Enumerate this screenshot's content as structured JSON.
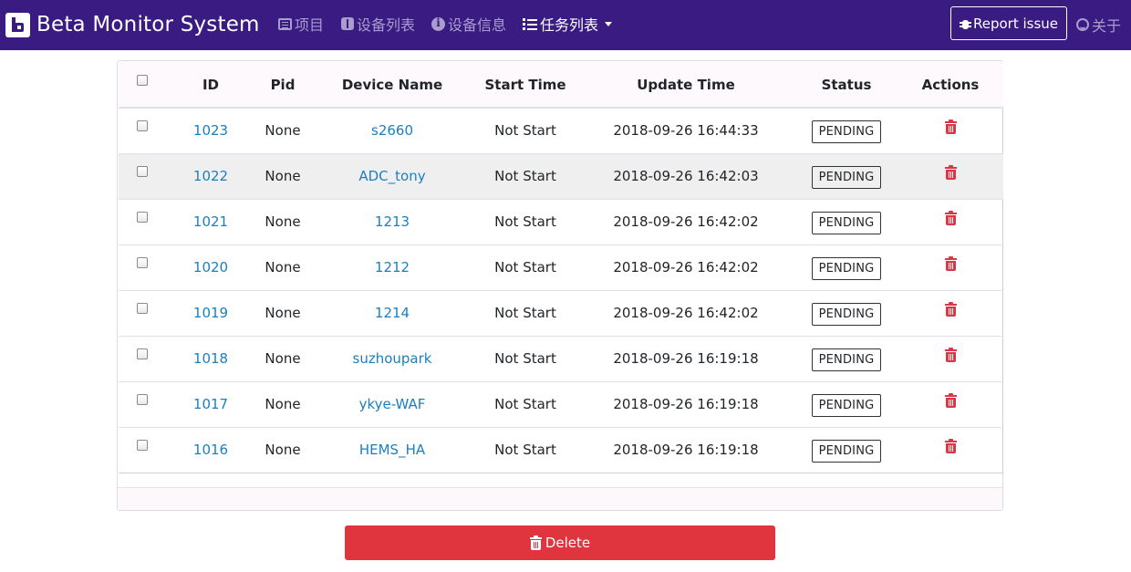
{
  "brand": {
    "title": "Beta Monitor System"
  },
  "nav": {
    "items": [
      {
        "label": "项目",
        "icon": "list-icon"
      },
      {
        "label": "设备列表",
        "icon": "switch-icon"
      },
      {
        "label": "设备信息",
        "icon": "info-icon"
      },
      {
        "label": "任务列表",
        "icon": "tasks-icon",
        "active": true
      }
    ],
    "report_label": "Report issue",
    "about_label": "关于"
  },
  "table": {
    "headers": [
      "",
      "ID",
      "Pid",
      "Device Name",
      "Start Time",
      "Update Time",
      "Status",
      "Actions"
    ],
    "rows": [
      {
        "id": "1023",
        "pid": "None",
        "device": "s2660",
        "start": "Not Start",
        "update": "2018-09-26 16:44:33",
        "status": "PENDING"
      },
      {
        "id": "1022",
        "pid": "None",
        "device": "ADC_tony",
        "start": "Not Start",
        "update": "2018-09-26 16:42:03",
        "status": "PENDING"
      },
      {
        "id": "1021",
        "pid": "None",
        "device": "1213",
        "start": "Not Start",
        "update": "2018-09-26 16:42:02",
        "status": "PENDING"
      },
      {
        "id": "1020",
        "pid": "None",
        "device": "1212",
        "start": "Not Start",
        "update": "2018-09-26 16:42:02",
        "status": "PENDING"
      },
      {
        "id": "1019",
        "pid": "None",
        "device": "1214",
        "start": "Not Start",
        "update": "2018-09-26 16:42:02",
        "status": "PENDING"
      },
      {
        "id": "1018",
        "pid": "None",
        "device": "suzhoupark",
        "start": "Not Start",
        "update": "2018-09-26 16:19:18",
        "status": "PENDING"
      },
      {
        "id": "1017",
        "pid": "None",
        "device": "ykye-WAF",
        "start": "Not Start",
        "update": "2018-09-26 16:19:18",
        "status": "PENDING"
      },
      {
        "id": "1016",
        "pid": "None",
        "device": "HEMS_HA",
        "start": "Not Start",
        "update": "2018-09-26 16:19:18",
        "status": "PENDING"
      }
    ]
  },
  "actions": {
    "delete_label": "Delete"
  },
  "colors": {
    "navbar": "#3a1b82",
    "link": "#1a7fc0",
    "danger": "#dc3545"
  }
}
